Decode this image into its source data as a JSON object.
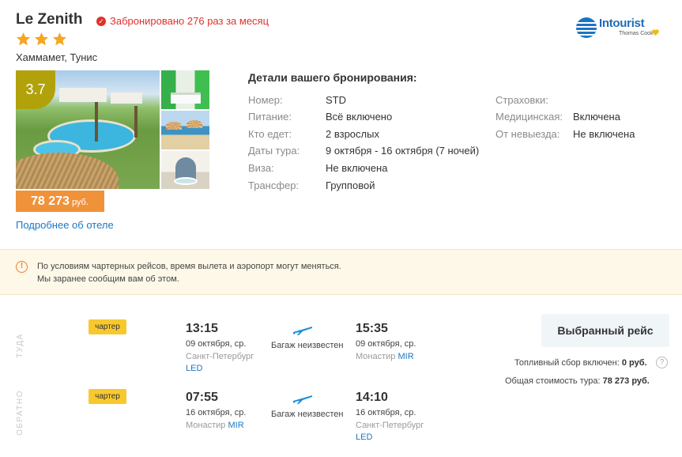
{
  "hotel": {
    "name": "Le Zenith",
    "booked_text": "Забронировано 276 раз за месяц",
    "stars": 3,
    "location": "Хаммамет, Тунис",
    "rating": "3.7",
    "price": "78 273",
    "price_currency": "руб.",
    "more_link": "Подробнее об отеле"
  },
  "operator": {
    "brand": "Intourist",
    "sub": "Thomas Cook"
  },
  "details": {
    "title": "Детали вашего бронирования:",
    "left": [
      {
        "label": "Номер:",
        "value": "STD"
      },
      {
        "label": "Питание:",
        "value": "Всё включено"
      },
      {
        "label": "Кто едет:",
        "value": "2 взрослых"
      },
      {
        "label": "Даты тура:",
        "value": "9 октября - 16 октября (7 ночей)"
      },
      {
        "label": "Виза:",
        "value": "Не включена"
      },
      {
        "label": "Трансфер:",
        "value": "Групповой"
      }
    ],
    "right": [
      {
        "label": "Страховки:",
        "value": ""
      },
      {
        "label": "Медицинская:",
        "value": "Включена"
      },
      {
        "label": "От невыезда:",
        "value": "Не включена"
      }
    ]
  },
  "notice": {
    "line1": "По условиям чартерных рейсов, время вылета и аэропорт могут меняться.",
    "line2": "Мы заранее сообщим вам об этом."
  },
  "flights": {
    "outbound": {
      "direction": "ТУДА",
      "badge": "чартер",
      "dep_time": "13:15",
      "dep_date": "09 октября, ср.",
      "dep_city": "Санкт-Петербург",
      "dep_code": "LED",
      "baggage": "Багаж неизвестен",
      "arr_time": "15:35",
      "arr_date": "09 октября, ср.",
      "arr_city": "Монастир",
      "arr_code": "MIR"
    },
    "return": {
      "direction": "ОБРАТНО",
      "badge": "чартер",
      "dep_time": "07:55",
      "dep_date": "16 октября, ср.",
      "dep_city": "Монастир",
      "dep_code": "MIR",
      "baggage": "Багаж неизвестен",
      "arr_time": "14:10",
      "arr_date": "16 октября, ср.",
      "arr_city": "Санкт-Петербург",
      "arr_code": "LED"
    }
  },
  "summary": {
    "button": "Выбранный рейс",
    "fuel_label": "Топливный сбор включен:",
    "fuel_value": "0 руб.",
    "total_label": "Общая стоимость тура:",
    "total_value": "78 273 руб."
  },
  "colors": {
    "accent_blue": "#1d77c1",
    "alert_red": "#e0312b",
    "price_orange": "#f0923a",
    "rating_olive": "#b1a20c",
    "charter_yellow": "#f8c92f",
    "star_orange": "#f5a623"
  }
}
